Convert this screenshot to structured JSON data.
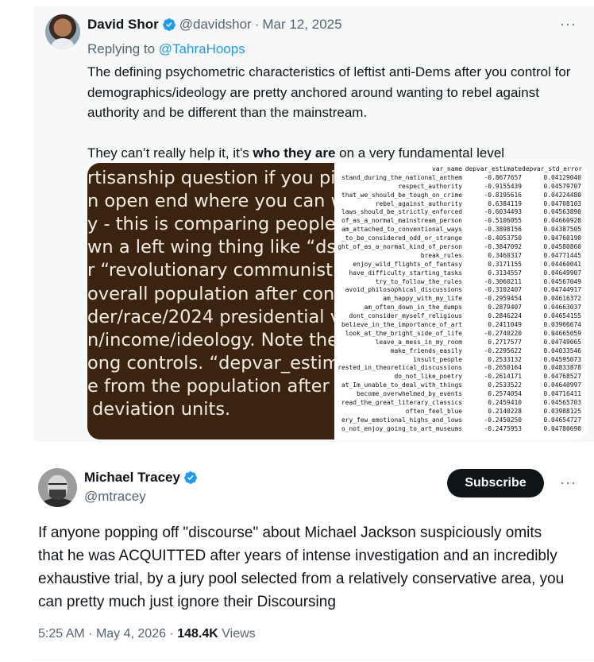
{
  "quoted_tweet": {
    "author_name": "David Shor",
    "handle": "@davidshor",
    "separator": "·",
    "date": "Mar 12, 2025",
    "reply_prefix": "Replying to",
    "reply_to": "@TahraHoops",
    "more_label": "···",
    "text_p1": "The defining psychometric characteristics of leftist anti-Dems after you control for demographics/ideology are pretty anchored around wanting to rebel against authority and be different than the mainstream.",
    "text_p2_before": "They can’t really help it, it’s ",
    "text_p2_bold": "who they are",
    "text_p2_after": " on a very fundamental level",
    "media_left_lines": [
      "rtisanship question if you pick",
      "n open end where you can wr",
      "y - this is comparing people w",
      "wn a left wing thing like “dsa”",
      "r “revolutionary communist” o",
      "overall population after contr",
      "der/race/2024 presidential vo",
      "n/income/ideology. Note thes",
      "ong controls. “depvar_estimat",
      "e from the population after co",
      "deviation units."
    ],
    "table_header": [
      "var_name",
      "depvar_estimate",
      "depvar_std_error"
    ],
    "table_rows": [
      [
        "stand_during_the_national_anthem",
        "-0.8677657",
        "0.04129040"
      ],
      [
        "respect_authority",
        "-0.9155439",
        "0.04579707"
      ],
      [
        "that_we_should_be_tough_on_crime",
        "-0.8195616",
        "0.04224480"
      ],
      [
        "rebel_against_authority",
        "0.6384119",
        "0.04708103"
      ],
      [
        "laws_should_be_strictly_enforced",
        "-0.6034493",
        "0.04563890"
      ],
      [
        "of_as_a_normal_mainstream_person",
        "-0.5106055",
        "0.04660928"
      ],
      [
        "am_attached_to_conventional_ways",
        "-0.3898156",
        "0.04387505"
      ],
      [
        "_to_be_considered_odd_or_strange",
        "-0.4053750",
        "0.04760190"
      ],
      [
        "ght_of_as_a_normal_kind_of_person",
        "-0.3847092",
        "0.04580860"
      ],
      [
        "break_rules",
        "0.3460317",
        "0.04771445"
      ],
      [
        "enjoy_wild_flights_of_fantasy",
        "0.3171155",
        "0.04460041"
      ],
      [
        "have_difficulty_starting_tasks",
        "0.3134557",
        "0.04649907"
      ],
      [
        "try_to_follow_the_rules",
        "-0.3060211",
        "0.04567049"
      ],
      [
        "avoid_philosophical_discussions",
        "-0.3102407",
        "0.04744917"
      ],
      [
        "am_happy_with_my_life",
        "-0.2959454",
        "0.04616372"
      ],
      [
        "am_often_down_in_the_dumps",
        "0.2879407",
        "0.04663037"
      ],
      [
        "dont_consider_myself_religious",
        "0.2846224",
        "0.04654155"
      ],
      [
        "believe_in_the_importance_of_art",
        "0.2411049",
        "0.03966674"
      ],
      [
        "look_at_the_bright_side_of_life",
        "-0.2740220",
        "0.04665059"
      ],
      [
        "leave_a_mess_in_my_room",
        "0.2717577",
        "0.04749065"
      ],
      [
        "make_friends_easily",
        "-0.2295622",
        "0.04033546"
      ],
      [
        "insult_people",
        "0.2533132",
        "0.04595073"
      ],
      [
        "rested_in_theoretical_discussions",
        "-0.2650164",
        "0.04833878"
      ],
      [
        "do_not_like_poetry",
        "-0.2614171",
        "0.04768527"
      ],
      [
        "at_Im_unable_to_deal_with_things",
        "0.2533522",
        "0.04640997"
      ],
      [
        "become_overwhelmed_by_events",
        "0.2574054",
        "0.04716411"
      ],
      [
        "read_the_great_literary_classics",
        "0.2459410",
        "0.04565703"
      ],
      [
        "often_feel_blue",
        "0.2140228",
        "0.03988125"
      ],
      [
        "ery_few_emotional_highs_and_lows",
        "-0.2450250",
        "0.04654727"
      ],
      [
        "o_not_enjoy_going_to_art_museums",
        "-0.2475953",
        "0.04780690"
      ]
    ]
  },
  "main_tweet": {
    "author_name": "Michael Tracey",
    "handle": "@mtracey",
    "subscribe_label": "Subscribe",
    "more_label": "···",
    "text": "If anyone popping off \"discourse\" about Michael Jackson suspiciously omits that he was ACQUITTED after years of intense investigation and an incredibly exhaustive trial, by a jury pool selected from a relatively conservative area, you can pretty much just ignore their Discoursing",
    "time": "5:25 AM",
    "separator": "·",
    "date": "May 4, 2026",
    "views_count": "148.4K",
    "views_label": "Views"
  },
  "colors": {
    "accent": "#1d9bf0",
    "text_primary": "#0f1419",
    "text_secondary": "#536471",
    "quote_background": "#f7f9f9",
    "media_dark": "#3a2410"
  },
  "icons": {
    "verified": "verified-badge-icon",
    "more": "more-icon"
  }
}
